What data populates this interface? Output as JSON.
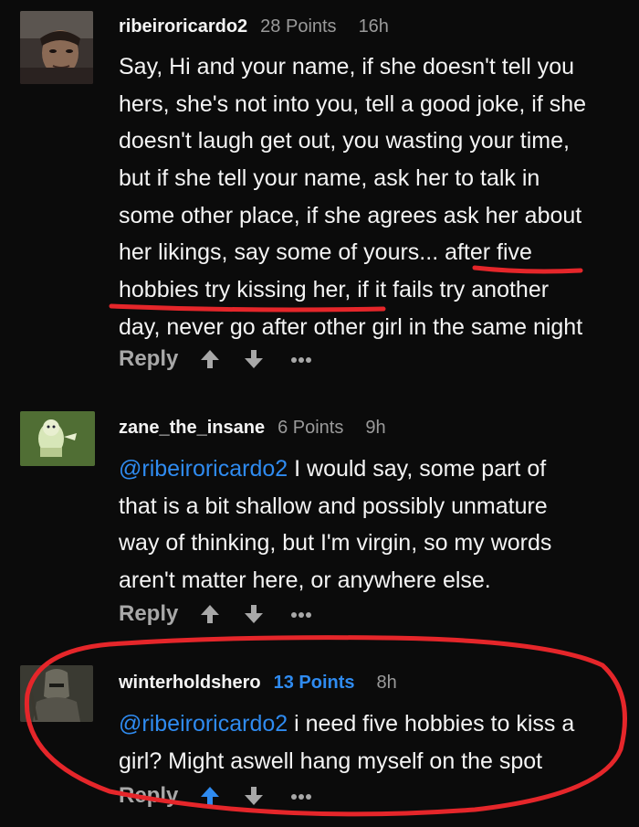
{
  "comments": [
    {
      "username": "ribeiroricardo2",
      "points": "28 Points",
      "time": "16h",
      "body_lines": [
        "Say, Hi and your name, if she doesn't tell you",
        "hers, she's not into you, tell a good joke, if she",
        "doesn't laugh get out, you wasting your time,",
        "but if she tell your name, ask her to talk in",
        "some other place, if she agrees ask her about",
        "her likings, say some of yours... after five",
        "hobbies try kissing her, if it fails try another",
        "day, never go after other girl in the same night"
      ],
      "reply_label": "Reply"
    },
    {
      "username": "zane_the_insane",
      "points": "6 Points",
      "time": "9h",
      "mention": "@ribeiroricardo2",
      "body_lines": [
        " I would say, some part of",
        "that is a bit shallow and possibly unmature",
        "way of thinking, but I'm virgin, so my words",
        "aren't matter here, or anywhere else."
      ],
      "reply_label": "Reply"
    },
    {
      "username": "winterholdshero",
      "points": "13 Points",
      "time": "8h",
      "mention": "@ribeiroricardo2",
      "body_lines": [
        " i need five hobbies to kiss a",
        "girl? Might aswell hang myself on the spot"
      ],
      "reply_label": "Reply"
    }
  ],
  "icons": {
    "upvote": "arrow-up-icon",
    "downvote": "arrow-down-icon",
    "more": "more-dots-icon"
  },
  "colors": {
    "background": "#0b0b0b",
    "text": "#f4f4f4",
    "muted": "#9a9a9a",
    "accent_blue": "#2f8bf0",
    "annotation_red": "#e5262a"
  }
}
